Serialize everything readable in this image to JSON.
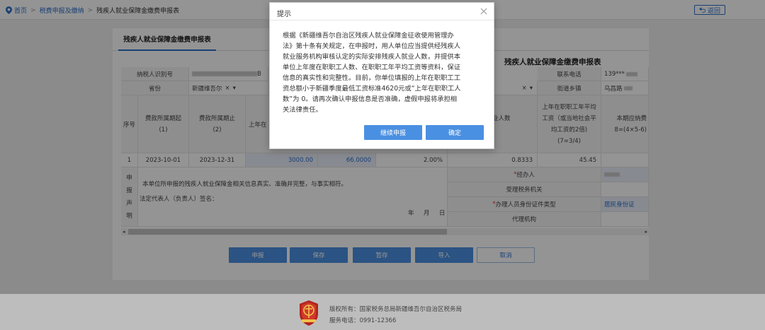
{
  "breadcrumb": {
    "home": "首页",
    "level2": "税费申报及缴纳",
    "current": "残疾人就业保障金缴费申报表"
  },
  "back_button": "返回",
  "tab": "残疾人就业保障金缴费申报表",
  "form_title": "残疾人就业保障金缴费申报表",
  "row1": {
    "taxpayer_id_label": "纳税人识别号",
    "taxpayer_id_tail": "B",
    "phone_label": "联系电话",
    "phone_value": "139***"
  },
  "row2": {
    "province_label": "省份",
    "province_value": "新疆维吾尔",
    "select_clear": "×",
    "select_arrow": "▾",
    "street_label": "街道乡镇",
    "street_value": "乌昌路"
  },
  "header": {
    "seq": "序号",
    "start_line1": "费款所属期起",
    "start_line2": "(1)",
    "end_line1": "费款所属期止",
    "end_line2": "(2)",
    "prev_year_partial": "上年在",
    "disabled_line1": "疾人就业人数",
    "disabled_line2": ")",
    "avg_wage_line1": "上年在职职工年平均",
    "avg_wage_line2": "工资（或当地社会平",
    "avg_wage_line3": "均工资的2倍)",
    "avg_wage_line4": "(7=3/4)",
    "payable_line1": "本期应纳费",
    "payable_line2": "8=(4×5-6)"
  },
  "data_row": {
    "seq": "1",
    "start": "2023-10-01",
    "end": "2023-12-31",
    "value_a": "3000.00",
    "value_b": "66.0000",
    "ratio": "2.00%",
    "disabled_count": "0.8333",
    "avg_wage": "45.45"
  },
  "declaration": {
    "side_chars": [
      "申",
      "报",
      "声",
      "明"
    ],
    "statement": "本单位所申报的残疾人就业保障金相关信息真实、准确并完整，与事实相符。",
    "legal_rep": "法定代表人（负责人）签名：",
    "date_year": "年",
    "date_month": "月",
    "date_day": "日",
    "agent_star": "*",
    "agent_label": "经办人",
    "tax_authority_label": "受理税务机关",
    "id_type_star": "*",
    "id_type_label": "办理人员身份证件类型",
    "id_type_value": "居民身份证",
    "agency_label": "代理机构"
  },
  "buttons": {
    "submit": "申报",
    "save": "保存",
    "temp_save": "暂存",
    "import": "导入",
    "cancel": "取消"
  },
  "modal": {
    "title": "提示",
    "lines": [
      "根据《新疆维吾尔自治区残疾人就业保障金征收使用管理办",
      "法》第十条有关规定，在申报时，用人单位应当提供经残疾人",
      "就业服务机构审核认定的实际安排残疾人就业人数，并提供本",
      "单位上年度在职职工人数、在职职工年平均工资等资料，保证",
      "信息的真实性和完整性。目前，你单位填报的上年在职职工工",
      "资总额小于新疆季度最低工资标准4620元或“上年在职职工人",
      "数”为 0。请再次确认申报信息是否准确，虚假申报将承担相",
      "关法律责任。"
    ],
    "continue_button": "继续申报",
    "confirm_button": "确定"
  },
  "footer": {
    "copyright": "版权所有：国家税务总局新疆维吾尔自治区税务局",
    "phone": "服务电话：0991-12366"
  },
  "colors": {
    "primary": "#4a90e2",
    "link": "#2d6ec8",
    "required": "#e03030",
    "overlay": "rgba(0,0,0,0.42)"
  }
}
